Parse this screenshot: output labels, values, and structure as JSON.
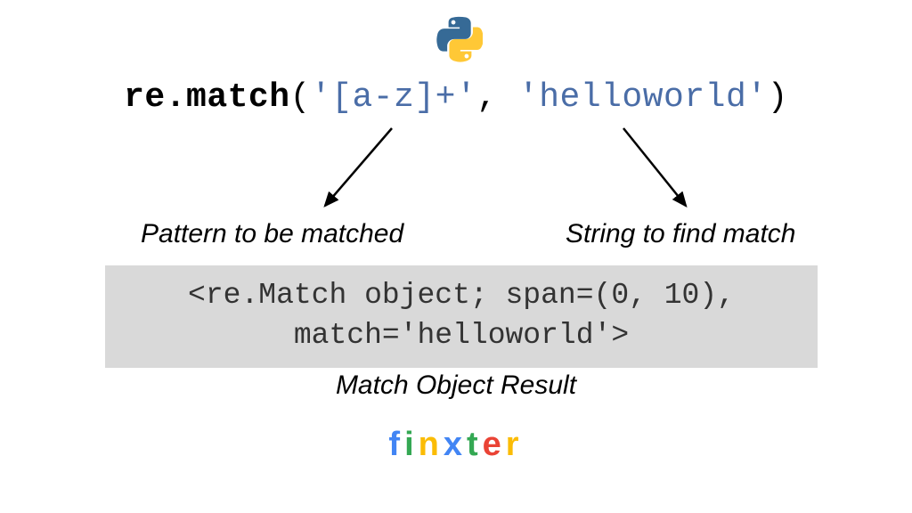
{
  "code": {
    "func": "re.match",
    "open": "(",
    "arg1": "'[a-z]+'",
    "comma": ", ",
    "arg2": "'helloworld'",
    "close": ")"
  },
  "labels": {
    "pattern": "Pattern to be matched",
    "string": "String to find match",
    "result": "Match Object Result"
  },
  "result_output": "<re.Match object; span=(0, 10), match='helloworld'>",
  "brand_letters": [
    "f",
    "i",
    "n",
    "x",
    "t",
    "e",
    "r"
  ],
  "icons": {
    "python_logo": "python-logo-icon"
  }
}
